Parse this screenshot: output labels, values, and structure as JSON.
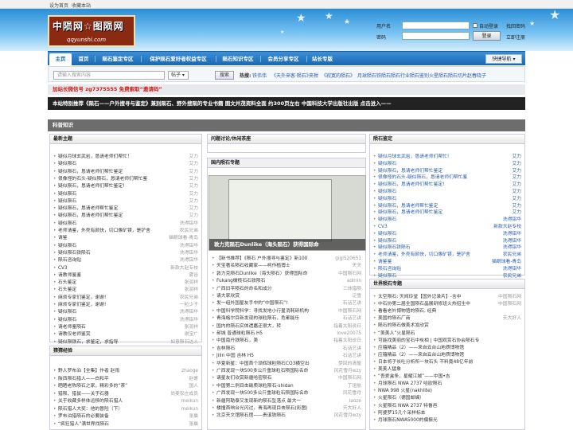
{
  "topbar": {
    "set_home": "设为首页",
    "bookmark": "收藏本站"
  },
  "logo": {
    "cn": "中陨网☆图陨网",
    "en": "qqyunshi.com"
  },
  "login": {
    "user_label": "用户名",
    "pass_label": "密码",
    "auto": "自动登录",
    "find_pw": "找回密码",
    "login": "登录",
    "register": "立即注册"
  },
  "nav": {
    "items": [
      "主页",
      "首页",
      "陨石鉴定专区",
      "保护陨石爱好者权益专区",
      "陨石知识专区",
      "会员分享专区",
      "站长专版"
    ],
    "quick": "快捷导航 ▾"
  },
  "search": {
    "placeholder": "请输入搜索内容",
    "type": "帖子 ▾",
    "button": "搜索",
    "hot_label": "热搜:",
    "hot": [
      "铁伟伟",
      "《天外来客·陨石》",
      "夹柑",
      "《寂寞的陨石》",
      "月球陨石",
      "铁陨石",
      "陨石行业",
      "陨石鉴别",
      "火星陨石",
      "陨石切片",
      "赵春晓子"
    ]
  },
  "promo": "加站长微信号 zg7375555 免费索取“邀请码”",
  "banner": "本站特别推荐《陨石——户外搜寻与鉴定》兼别陨石、野外搜陨的专业书籍 图文并茂资料全面 约300页左右 中国科技大学出版社出版 点击进入——",
  "section": "科普知识",
  "left_top": {
    "title": "最新主题",
    "rows": [
      [
        "疑似月球玄武岩，恳请老师们帮忙！",
        "艾力"
      ],
      [
        "疑似陨石",
        "艾力"
      ],
      [
        "疑似陨石，恳请老师们帮忙鉴定",
        "艾力"
      ],
      [
        "很像怪的石头-疑似陨石，恳请老师们帮忙鉴",
        "艾力"
      ],
      [
        "疑似陨石，恳请老师们帮忙鉴定!",
        "艾力"
      ],
      [
        "疑似陨石",
        "艾力"
      ],
      [
        "疑似陨石",
        "艾力"
      ],
      [
        "疑似陨石，恳请老师帮忙鉴定",
        "艾力"
      ],
      [
        "疑似陨石，恳请老师们帮忙鉴定",
        "艾力"
      ],
      [
        "疑似陨石",
        "洗得铝华"
      ],
      [
        "老师请鉴，外壳有颜快，切口像矿镁，是铲舍",
        "农民兄弟"
      ],
      [
        "请鉴",
        "猫眼球看-青岛"
      ],
      [
        "疑似陨石",
        "洗得铝华"
      ],
      [
        "疑似陨石铁陨石",
        "洗得铝华"
      ],
      [
        "陨石咨询贴",
        "洗得铝华"
      ],
      [
        "CV3",
        "新款大赵专校"
      ],
      [
        "请教师鉴鉴",
        "雾谷"
      ],
      [
        "石头鉴定",
        "张润祥"
      ],
      [
        "石头鉴定",
        "张润祥"
      ],
      [
        "麻烦专家们鉴定，谢谢!",
        "农民兄弟"
      ],
      [
        "麻烦专家们鉴定，谢谢!",
        "一粒少子"
      ],
      [
        "疑似陨石",
        "洗得铝华"
      ],
      [
        "疑似陨石",
        "洗得铝华"
      ],
      [
        "请老师鉴陨石",
        "张润祥"
      ],
      [
        "请教仅老师鉴赏",
        "谢宝广"
      ],
      [
        "疑似陨铁石，求鉴定，求指导",
        "如意陨石达人"
      ]
    ]
  },
  "left_bot": {
    "title": "猜猜经验",
    "rows": [
      [
        "野人罗布泊【全集】作者 赵雨",
        "zhaoge"
      ],
      [
        "陕西陨石猎人——白和平",
        "赵哥"
      ],
      [
        "晒晒老陈陨石之家，精彩多的“茶”",
        "国人"
      ],
      [
        "猎陨、猎鼠——关于石器",
        "尚麦农庄成员"
      ],
      [
        "关于收藏多样体运移的陨石猎人",
        "meikun"
      ],
      [
        "陨石猎人大奖：他的冒险（下）",
        "meikun"
      ],
      [
        "罗布泊猎陨石的必要装备",
        "张晨"
      ],
      [
        "“疯狂猎人”满世界找陨石",
        "张晨"
      ]
    ]
  },
  "mid_top": {
    "title": "问题讨论/休闲茶座"
  },
  "mid_photo": {
    "title": "国内陨石专题",
    "caption": "敦力克陨石Dunlike（海头陨石）获得国际命"
  },
  "mid_list": {
    "rows": [
      [
        "【新书推荐】《陨石 户外搜寻与鉴定》新100",
        "gigi520651"
      ],
      [
        "天宝著名陨石收藏家——柯作植博士",
        "天天"
      ],
      [
        "敦力克陨石Dunlike（海头陨石）获得国际命",
        "中国陨石网"
      ],
      [
        "Fukang橄榄石石铁陨石",
        "admin"
      ],
      [
        "广西旧平陨石的命名和成分",
        "三体猎陨"
      ],
      [
        "请大家欣赏",
        "泛雪"
      ],
      [
        "发一组外国星友手中的“中国陨石”!",
        "石话艺讲"
      ],
      [
        "中国科学院科学：寻找发地小行星消耗研机构",
        "中国陨石网"
      ],
      [
        "青海格尔目新发现的球粒陨石，危都能乐",
        "石话艺讲"
      ],
      [
        "国内的陨石实体遗嘉还很大，转",
        "指着太阳说日"
      ],
      [
        "郝城 普通球粒陨石 H5",
        "love20075"
      ],
      [
        "中国南丹铁陨石，美",
        "指着太阳说日"
      ],
      [
        "吉林陨石",
        "石话艺讲"
      ],
      [
        "Jilin 中国 吉林 H5",
        "石话艺讲"
      ],
      [
        "华夏新星：中国首个顽辉球粒陨石CO3横空出",
        "梦回的清屋"
      ],
      [
        "广西发现一块500多公斤重球粒石陨国际名命",
        "风花雪月wzy"
      ],
      [
        "请星友们欣赏新疆哈密陨石",
        "中国陨石网"
      ],
      [
        "中国第二例目击碳质球粒陨石-shidan",
        "丁谊航"
      ],
      [
        "广西发现一块500多公斤重球粒石陨国际名命",
        "风花雪月"
      ],
      [
        "新疆阿勒泰又发现新的陨石坠落点 最大一",
        "laoze"
      ],
      [
        "楼撞首响台光闪过，青海再现目击陨石(彩图)",
        "天大好人"
      ],
      [
        "北京天文馆陨石馆——贵溪铁陨石",
        "风花雪月wzy"
      ]
    ]
  },
  "right_top": {
    "title": "陨石鉴定",
    "rows": [
      [
        "疑似月球玄武岩，恳请老师们帮忙!",
        "艾力"
      ],
      [
        "疑似陨石",
        "艾力"
      ],
      [
        "疑似陨石，恳请老师们帮忙鉴定",
        "艾力"
      ],
      [
        "很像怪的石头-疑似陨石，恳请老师们帮忙鉴",
        "艾力"
      ],
      [
        "疑似陨石，恳请老师们帮忙鉴定!",
        "艾力"
      ],
      [
        "疑似陨石",
        "艾力"
      ],
      [
        "疑似陨石",
        "艾力"
      ],
      [
        "疑似陨石，恳请老师帮忙鉴定",
        "艾力"
      ],
      [
        "疑似陨石，恳请老师们帮忙鉴定",
        "艾力"
      ],
      [
        "疑似陨石",
        "洗得铝华"
      ],
      [
        "CV3",
        "新款大赵专校"
      ],
      [
        "疑似陨石",
        "洗得铝华"
      ],
      [
        "疑似陨石",
        "洗得铝华"
      ],
      [
        "疑似陨石铁陨石",
        "洗得铝华"
      ],
      [
        "老师请鉴，外壳有颜快，切口像矿镁，是铲舍",
        "农民兄弟"
      ],
      [
        "请鉴鉴",
        "猫眼球看-青岛"
      ],
      [
        "陨石咨询贴",
        "洗得铝华"
      ],
      [
        "疑似陨石",
        "农民兄弟"
      ]
    ]
  },
  "right_bot": {
    "title": "世界陨石专题",
    "rows": [
      [
        "太空陨石: 天阀玲堂【国外记录片】-含中",
        "中国陨石网"
      ],
      [
        "中石协第二届全国陨石晶展研修班火热招生中",
        "中国陨石网"
      ],
      [
        "看看老外博物馆的陨石, 经典",
        ""
      ],
      [
        "美国的陨石厂商",
        "天大好人"
      ],
      [
        "陨石的陨石做美术发欣赏",
        ""
      ],
      [
        "“美美人”火星陨石",
        ""
      ],
      [
        "可能找美丽的宝石中炭相 | 中国观赏石协会陨石专",
        ""
      ],
      [
        "应蕴精品（2）——来自云台山地质博物馆",
        ""
      ],
      [
        "应蕴精品（2）——来自云台山地质博物馆",
        ""
      ],
      [
        "日本将子长吐分析所一块石头 不料竟48亿年前",
        ""
      ],
      [
        "美美人猛象",
        ""
      ],
      [
        "“吾爱盒条，星耀江城”——中国•吉",
        ""
      ],
      [
        "月球陨石 NWA 2737 哈欧陨石",
        ""
      ],
      [
        "NWA 998 火星(nakhlite)",
        ""
      ],
      [
        "火星陨石（德国邮编）",
        ""
      ],
      [
        "火星陨石 NWA 2737 特鲁邑",
        ""
      ],
      [
        "阿婆罗15几个采样标本",
        ""
      ],
      [
        "月球陨石NWA5000的偏振光",
        ""
      ]
    ]
  },
  "colors": {
    "nav": "#1a67b2",
    "promo": "#d41a1a",
    "link": "#2a5db0"
  }
}
